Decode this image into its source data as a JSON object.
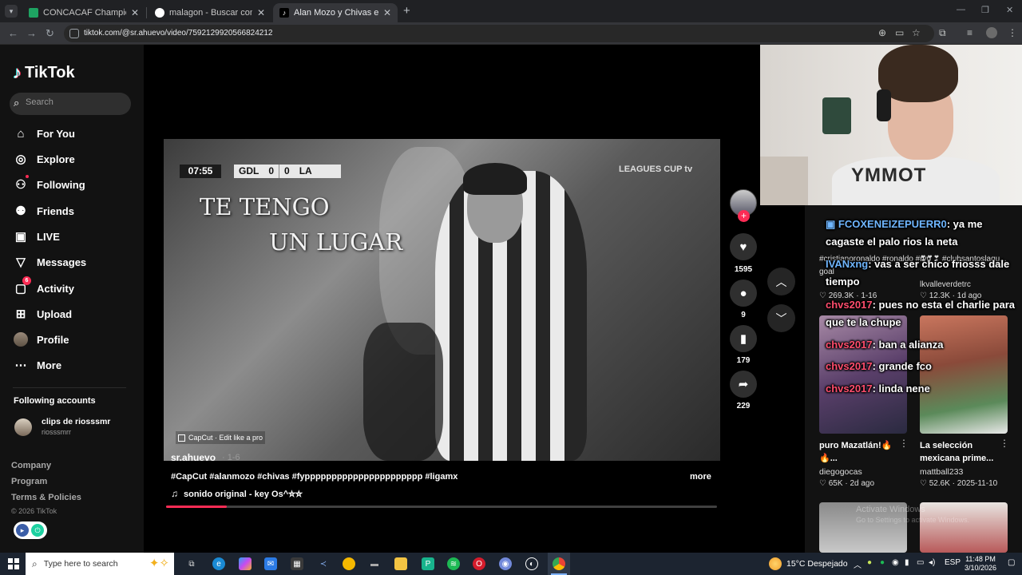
{
  "browser": {
    "tabs": [
      {
        "title": "CONCACAF Champions Cup pa",
        "favicon_color": "#1ea362",
        "active": false
      },
      {
        "title": "malagon - Buscar con Google",
        "favicon_color": "#ffffff",
        "active": false
      },
      {
        "title": "Alan Mozo y Chivas en la Liga",
        "favicon_color": "#000000",
        "active": true
      }
    ],
    "url": "tiktok.com/@sr.ahuevo/video/7592129920566824212"
  },
  "tiktok": {
    "logo": "TikTok",
    "search_placeholder": "Search",
    "nav": [
      {
        "label": "For You",
        "icon": "home-icon"
      },
      {
        "label": "Explore",
        "icon": "compass-icon"
      },
      {
        "label": "Following",
        "icon": "following-icon"
      },
      {
        "label": "Friends",
        "icon": "friends-icon"
      },
      {
        "label": "LIVE",
        "icon": "live-icon"
      },
      {
        "label": "Messages",
        "icon": "messages-icon"
      },
      {
        "label": "Activity",
        "icon": "activity-icon",
        "badge": "6"
      },
      {
        "label": "Upload",
        "icon": "upload-icon"
      },
      {
        "label": "Profile",
        "icon": "profile-icon"
      },
      {
        "label": "More",
        "icon": "more-icon"
      }
    ],
    "following_title": "Following accounts",
    "following_account": {
      "name": "clips de riosssmr",
      "handle": "riosssmrr"
    },
    "footer": [
      "Company",
      "Program",
      "Terms & Policies"
    ],
    "copyright": "© 2026 TikTok",
    "accent": "#fe2c55"
  },
  "video": {
    "scorebug": {
      "time": "07:55",
      "home": "GDL",
      "home_score": "0",
      "away_score": "0",
      "away": "LA"
    },
    "broadcast": "LEAGUES CUP  tv",
    "overlay_line1": "TE TENGO",
    "overlay_line2": "UN LUGAR",
    "capcut": "CapCut · Edit like a pro",
    "author": "sr.ahuevo",
    "date": "· 1-6",
    "caption": "#CapCut #alanmozo #chivas #fypppppppppppppppppppppp #ligamx",
    "more": "more",
    "music": "sonido original - key Os^⛥⛥",
    "progress": 0.11,
    "likes": "1595",
    "comments": "9",
    "saves": "179",
    "shares": "229"
  },
  "webcam": {
    "shirt_text": "YMMOT"
  },
  "recommendations": [
    {
      "tags": "#cristianoronaldo #ronaldo #ryp",
      "user": "goal",
      "views": "269.3K",
      "date": "1-16"
    },
    {
      "tags": "❣❣❣ #clubsantoslagu...",
      "user": "lkvalleverdetrc",
      "views": "12.3K",
      "date": "1d ago"
    },
    {
      "title": "puro Mazatlán!🔥🔥...",
      "user": "diegogocas",
      "views": "65K",
      "date": "2d ago"
    },
    {
      "title": "La selección mexicana prime...",
      "user": "mattball233",
      "views": "52.6K",
      "date": "2025-11-10"
    }
  ],
  "chat": [
    {
      "user": "FCOXENEIZEPUERR0",
      "color": "#6fb6ff",
      "text": ": ya me cagaste el palo rios la neta"
    },
    {
      "user": "IVANxng",
      "color": "#6fb6ff",
      "text": ": vas a ser chico friosss dale tiempo"
    },
    {
      "user": "chvs2017",
      "color": "#ff4d6d",
      "text": ": pues no esta el charlie para que te la chupe"
    },
    {
      "user": "chvs2017",
      "color": "#ff4d6d",
      "text": ": ban a alianza"
    },
    {
      "user": "chvs2017",
      "color": "#ff4d6d",
      "text": ": grande fco"
    },
    {
      "user": "chvs2017",
      "color": "#ff4d6d",
      "text": ": linda nene"
    }
  ],
  "windows_watermark": {
    "line1": "Activate Windows",
    "line2": "Go to Settings to activate Windows."
  },
  "taskbar": {
    "search_placeholder": "Type here to search",
    "weather": "15°C  Despejado",
    "lang": "ESP",
    "time": "11:48 PM",
    "date": "3/10/2026"
  }
}
